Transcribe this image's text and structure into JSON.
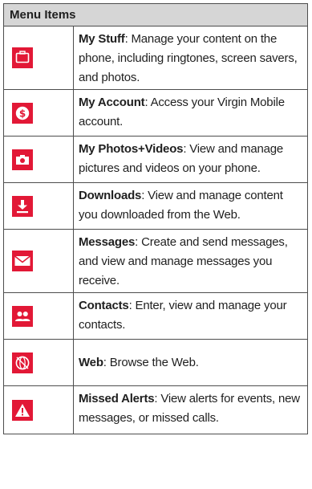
{
  "header": {
    "title": "Menu Items"
  },
  "rows": [
    {
      "icon": "briefcase-icon",
      "name": "My Stuff",
      "description": "Manage your content on the phone, including ringtones, screen savers, and photos."
    },
    {
      "icon": "dollar-icon",
      "name": "My Account",
      "description": "Access your Virgin Mobile account."
    },
    {
      "icon": "camera-icon",
      "name": "My Photos+Videos",
      "description": "View and manage pictures and videos on your phone."
    },
    {
      "icon": "download-icon",
      "name": "Downloads",
      "description": "View and manage content you downloaded from the Web."
    },
    {
      "icon": "envelope-icon",
      "name": "Messages",
      "description": "Create and send messages, and view and manage messages you receive."
    },
    {
      "icon": "contacts-icon",
      "name": "Contacts",
      "description": "Enter, view and manage your contacts."
    },
    {
      "icon": "globe-icon",
      "name": "Web",
      "description": "Browse the Web."
    },
    {
      "icon": "warning-icon",
      "name": "Missed Alerts",
      "description": "View alerts for events, new messages, or missed calls."
    }
  ],
  "colors": {
    "accent": "#e21836",
    "header_bg": "#d6d6d6",
    "border": "#4d4d4d"
  }
}
